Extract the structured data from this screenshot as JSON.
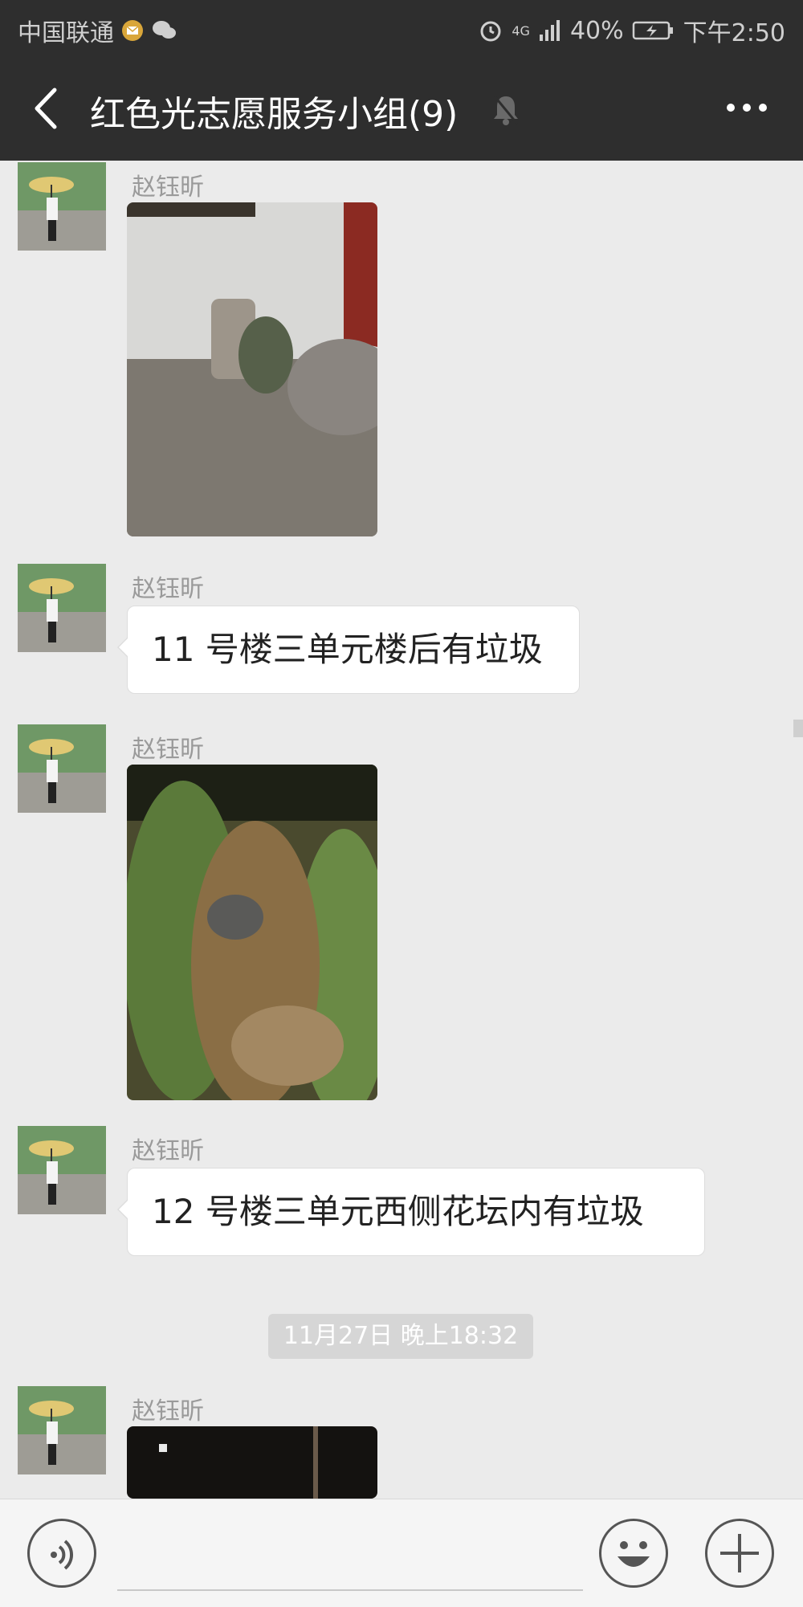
{
  "status_bar": {
    "carrier": "中国联通",
    "network": "4G",
    "battery": "40%",
    "time": "下午2:50",
    "icons": [
      "mail-notification-icon",
      "wechat-icon",
      "alarm-icon",
      "signal-icon",
      "battery-icon"
    ]
  },
  "header": {
    "title": "红色光志愿服务小组(9)",
    "back_icon": "back-chevron-icon",
    "mute_icon": "muted-bell-icon",
    "more_icon": "more-dots-icon"
  },
  "messages": [
    {
      "type": "image",
      "sender": "赵钰昕",
      "image_desc": "wall-corner-trash"
    },
    {
      "type": "text",
      "sender": "赵钰昕",
      "text": "11 号楼三单元楼后有垃圾"
    },
    {
      "type": "image",
      "sender": "赵钰昕",
      "image_desc": "flowerbed-trash"
    },
    {
      "type": "text",
      "sender": "赵钰昕",
      "text": "12 号楼三单元西侧花坛内有垃圾"
    },
    {
      "type": "timestamp",
      "text": "11月27日 晚上18:32"
    },
    {
      "type": "image",
      "sender": "赵钰昕",
      "image_desc": "night-photo"
    }
  ],
  "input_bar": {
    "voice_icon": "voice-input-icon",
    "emoji_icon": "emoji-icon",
    "plus_icon": "plus-icon",
    "input_value": ""
  },
  "colors": {
    "header_bg": "#2e2e2e",
    "chat_bg": "#ebebeb",
    "bubble_bg": "#ffffff",
    "timestamp_bg": "#d6d6d6"
  }
}
